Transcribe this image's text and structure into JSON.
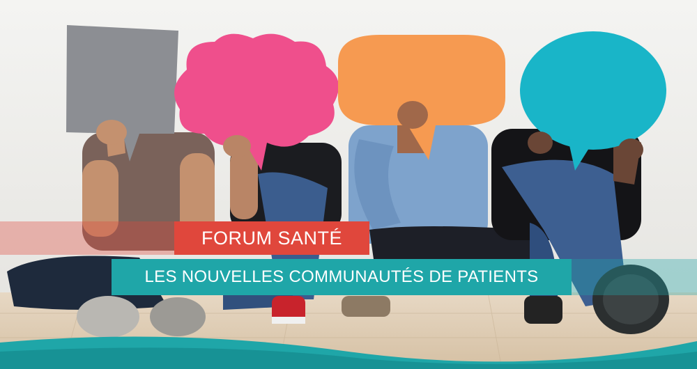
{
  "banner": {
    "title": "FORUM SANTÉ",
    "subtitle": "LES NOUVELLES COMMUNAUTÉS DE PATIENTS"
  },
  "colors": {
    "red_banner": "#e0473c",
    "teal_banner": "#1fa6a8",
    "gray_bubble": "#8c8e93",
    "pink_bubble": "#ef4f8c",
    "orange_bubble": "#f69a51",
    "blue_bubble": "#19b5c8"
  }
}
